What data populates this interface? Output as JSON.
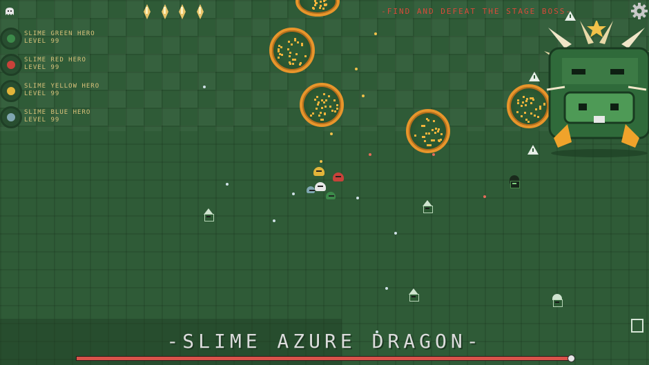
{
  "hud": {
    "objective": "-FIND AND DEFEAT THE STAGE BOSS-",
    "gem_count": 4,
    "top_left_icon": "ghost-icon",
    "settings_icon": "gear-icon",
    "bottom_right_icon": "exit-icon"
  },
  "players": [
    {
      "name": "SLIME GREEN HERO",
      "level": "LEVEL 99",
      "color": "#3c8a4a"
    },
    {
      "name": "SLIME RED HERO",
      "level": "LEVEL 99",
      "color": "#c8423a"
    },
    {
      "name": "SLIME YELLOW HERO",
      "level": "LEVEL 99",
      "color": "#e2b43a"
    },
    {
      "name": "SLIME BLUE HERO",
      "level": "LEVEL 99",
      "color": "#7fa6b0"
    }
  ],
  "boss": {
    "name": "-SLIME AZURE DRAGON-",
    "health_fraction": 1.0,
    "bar_color": "#d9534a"
  },
  "colors": {
    "field": "#2f5b37",
    "orb_ring": "#e8952b",
    "text_gold": "#d9c27a",
    "objective_red": "#d94a3a"
  }
}
